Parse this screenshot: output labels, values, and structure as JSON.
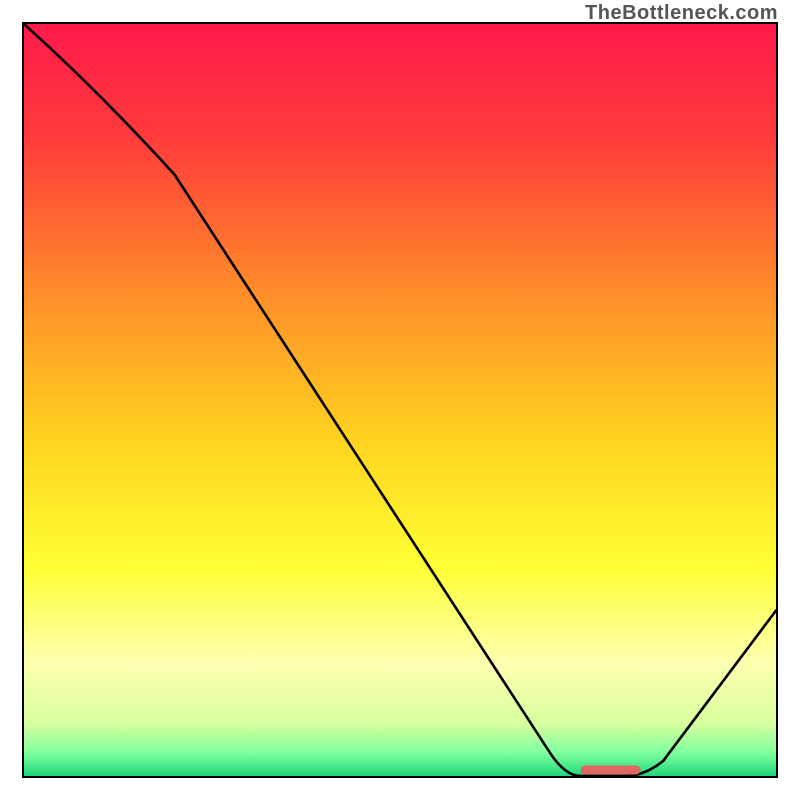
{
  "watermark": "TheBottleneck.com",
  "chart_data": {
    "type": "line",
    "title": "",
    "xlabel": "",
    "ylabel": "",
    "xlim": [
      0,
      100
    ],
    "ylim": [
      0,
      100
    ],
    "x": [
      0,
      20,
      70,
      74,
      80,
      85,
      100
    ],
    "values": [
      100,
      80,
      3,
      0,
      0,
      2,
      22
    ],
    "marker": {
      "x_range": [
        74,
        82
      ],
      "y": 0
    },
    "gradient_stops": [
      {
        "pos": 0.0,
        "color": "#ff1a4b"
      },
      {
        "pos": 0.15,
        "color": "#ff3b3b"
      },
      {
        "pos": 0.35,
        "color": "#ff8a2a"
      },
      {
        "pos": 0.55,
        "color": "#ffd21f"
      },
      {
        "pos": 0.72,
        "color": "#ffff33"
      },
      {
        "pos": 0.85,
        "color": "#fdffb0"
      },
      {
        "pos": 0.93,
        "color": "#d8ff9e"
      },
      {
        "pos": 0.97,
        "color": "#7dff9e"
      },
      {
        "pos": 1.0,
        "color": "#1fd67a"
      }
    ]
  }
}
